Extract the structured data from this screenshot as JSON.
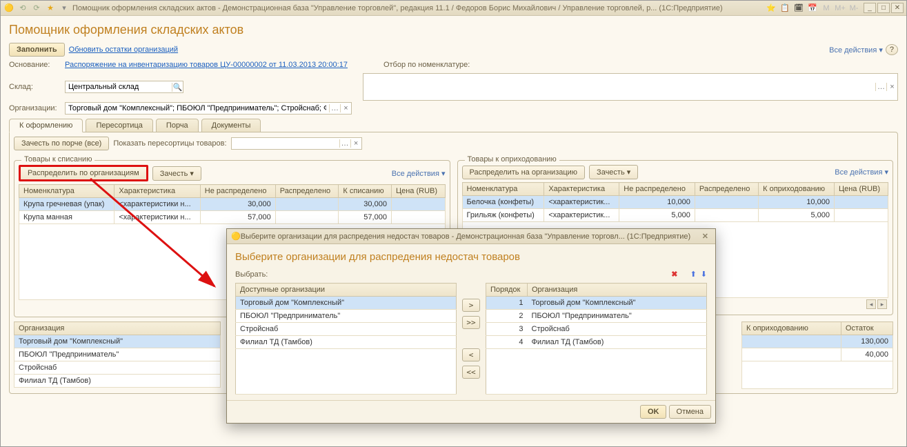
{
  "titlebar": "Помощник оформления складских актов - Демонстрационная база \"Управление торговлей\", редакция 11.1 / Федоров Борис Михайлович / Управление торговлей, р...   (1С:Предприятие)",
  "page_title": "Помощник оформления складских актов",
  "fill_btn": "Заполнить",
  "refresh_link": "Обновить остатки организаций",
  "all_actions": "Все действия",
  "labels": {
    "basis": "Основание:",
    "basis_link": "Распоряжение на инвентаризацию товаров ЦУ-00000002 от 11.03.2013 20:00:17",
    "warehouse": "Склад:",
    "warehouse_value": "Центральный склад",
    "orgs": "Организации:",
    "orgs_value": "Торговый дом \"Комплексный\"; ПБОЮЛ \"Предприниматель\"; Стройснаб; Фи",
    "filter_nomen": "Отбор по номенклатуре:"
  },
  "tabs": [
    "К оформлению",
    "Пересортица",
    "Порча",
    "Документы"
  ],
  "controls": {
    "zachest_porche": "Зачесть по порче (все)",
    "show_peresort": "Показать пересортицы товаров:",
    "dist_orgs": "Распределить по организациям",
    "dist_na_org": "Распределить на организацию",
    "zachest": "Зачесть"
  },
  "group1_title": "Товары к списанию",
  "group2_title": "Товары к оприходованию",
  "grid1": {
    "headers": [
      "Номенклатура",
      "Характеристика",
      "Не распределено",
      "Распределено",
      "К списанию",
      "Цена (RUB)"
    ],
    "rows": [
      {
        "n": "Крупа гречневая (упак)",
        "ch": "<характеристики н...",
        "nd": "30,000",
        "rd": "",
        "ks": "30,000",
        "c": "",
        "sel": true
      },
      {
        "n": "Крупа манная",
        "ch": "<характеристики н...",
        "nd": "57,000",
        "rd": "",
        "ks": "57,000",
        "c": "",
        "sel": false
      }
    ]
  },
  "grid2": {
    "headers": [
      "Номенклатура",
      "Характеристика",
      "Не распределено",
      "Распределено",
      "К оприходованию",
      "Цена (RUB)"
    ],
    "rows": [
      {
        "n": "Белочка (конфеты)",
        "ch": "<характеристик...",
        "nd": "10,000",
        "rd": "",
        "ks": "10,000",
        "c": "",
        "sel": true
      },
      {
        "n": "Грильяж (конфеты)",
        "ch": "<характеристик...",
        "nd": "5,000",
        "rd": "",
        "ks": "5,000",
        "c": "",
        "sel": false
      }
    ]
  },
  "bottom_left": {
    "header": "Организация",
    "rows": [
      "Торговый дом \"Комплексный\"",
      "ПБОЮЛ \"Предприниматель\"",
      "Стройснаб",
      "Филиал ТД (Тамбов)"
    ]
  },
  "bottom_right": {
    "headers": [
      "К оприходованию",
      "Остаток"
    ],
    "rows": [
      {
        "a": "",
        "b": "130,000",
        "sel": true
      },
      {
        "a": "",
        "b": "40,000",
        "sel": false
      }
    ]
  },
  "dialog": {
    "titlebar": "Выберите организации для распредения недостач товаров - Демонстрационная база \"Управление торговл...   (1С:Предприятие)",
    "title": "Выберите организации для распредения недостач товаров",
    "choose_lbl": "Выбрать:",
    "avail_hdr": "Доступные организации",
    "avail": [
      "Торговый дом \"Комплексный\"",
      "ПБОЮЛ \"Предприниматель\"",
      "Стройснаб",
      "Филиал ТД (Тамбов)"
    ],
    "sel_hdrs": [
      "Порядок",
      "Организация"
    ],
    "selected": [
      {
        "i": "1",
        "n": "Торговый дом \"Комплексный\""
      },
      {
        "i": "2",
        "n": "ПБОЮЛ \"Предприниматель\""
      },
      {
        "i": "3",
        "n": "Стройснаб"
      },
      {
        "i": "4",
        "n": "Филиал ТД (Тамбов)"
      }
    ],
    "ok": "OK",
    "cancel": "Отмена",
    "move": {
      "r": ">",
      "rr": ">>",
      "l": "<",
      "ll": "<<"
    }
  }
}
